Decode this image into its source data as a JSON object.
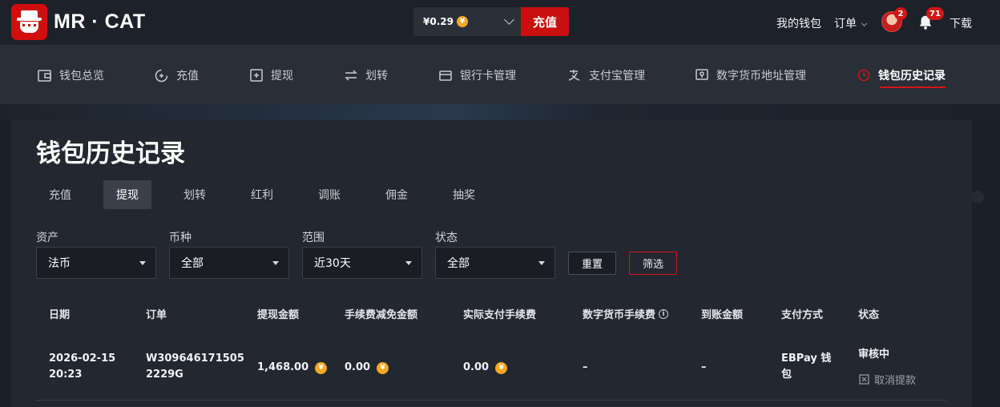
{
  "header": {
    "brand": "MR · CAT",
    "balance": "¥0.29",
    "coin_symbol": "¥",
    "recharge_label": "充值",
    "my_wallet": "我的钱包",
    "orders": "订单",
    "avatar_badge": "2",
    "notification_badge": "71",
    "download": "下载"
  },
  "nav": {
    "items": [
      {
        "label": "钱包总览",
        "icon": "wallet-icon"
      },
      {
        "label": "充值",
        "icon": "recharge-icon"
      },
      {
        "label": "提现",
        "icon": "withdraw-icon"
      },
      {
        "label": "划转",
        "icon": "transfer-icon"
      },
      {
        "label": "银行卡管理",
        "icon": "bank-card-icon"
      },
      {
        "label": "支付宝管理",
        "icon": "alipay-icon"
      },
      {
        "label": "数字货币地址管理",
        "icon": "crypto-address-icon"
      },
      {
        "label": "钱包历史记录",
        "icon": "history-icon"
      }
    ],
    "active": "钱包历史记录"
  },
  "page": {
    "title": "钱包历史记录",
    "tabs": [
      "充值",
      "提现",
      "划转",
      "红利",
      "调账",
      "佣金",
      "抽奖"
    ],
    "active_tab": "提现"
  },
  "filters": {
    "asset": {
      "label": "资产",
      "value": "法币"
    },
    "currency": {
      "label": "币种",
      "value": "全部"
    },
    "range": {
      "label": "范围",
      "value": "近30天"
    },
    "status": {
      "label": "状态",
      "value": "全部"
    },
    "reset_label": "重置",
    "filter_label": "筛选"
  },
  "table": {
    "columns": [
      "日期",
      "订单",
      "提现金额",
      "手续费减免金额",
      "实际支付手续费",
      "数字货币手续费",
      "到账金额",
      "支付方式",
      "状态"
    ],
    "rows": [
      {
        "date": "2026-02-15",
        "time": "20:23",
        "order_line1": "W309646171505",
        "order_line2": "2229G",
        "amount": "1,468.00",
        "fee_waived": "0.00",
        "fee_paid": "0.00",
        "crypto_fee": "–",
        "received": "–",
        "method_line1": "EBPay 钱",
        "method_line2": "包",
        "status": "审核中",
        "cancel_label": "取消提款"
      }
    ]
  },
  "colors": {
    "accent_red": "#d31616",
    "coin": "#f5a623",
    "background": "#1b1f27"
  }
}
